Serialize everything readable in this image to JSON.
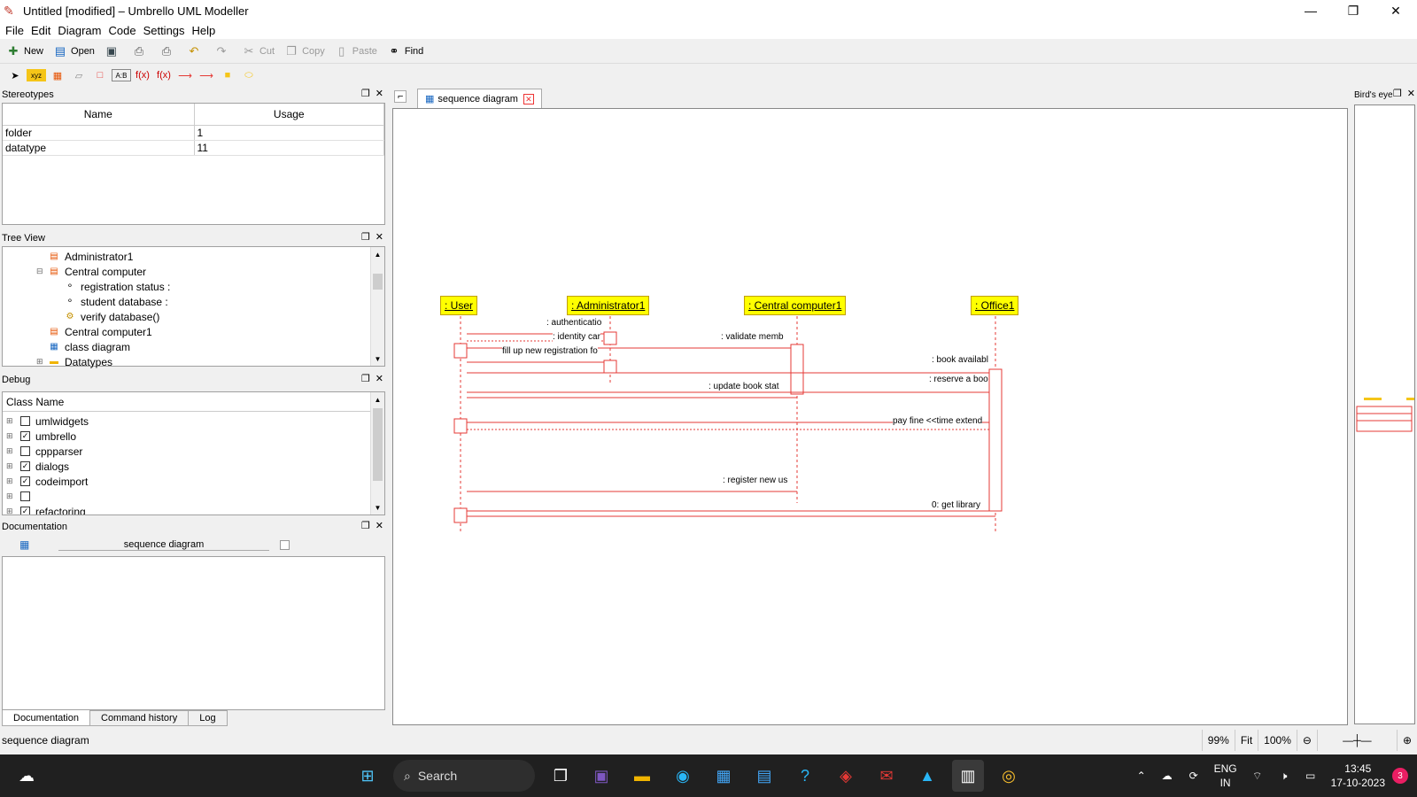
{
  "window": {
    "title": "Untitled [modified] – Umbrello UML Modeller",
    "minimize": "—",
    "maximize": "❐",
    "close": "✕"
  },
  "menu": [
    "File",
    "Edit",
    "Diagram",
    "Code",
    "Settings",
    "Help"
  ],
  "toolbar": {
    "new": "New",
    "open": "Open",
    "cut": "Cut",
    "copy": "Copy",
    "paste": "Paste",
    "find": "Find"
  },
  "stereotypes": {
    "title": "Stereotypes",
    "columns": [
      "Name",
      "Usage"
    ],
    "rows": [
      {
        "name": "folder",
        "usage": "1"
      },
      {
        "name": "datatype",
        "usage": "11"
      }
    ]
  },
  "tree_view": {
    "title": "Tree View",
    "items": [
      {
        "label": "Administrator1",
        "icon": "class-icon"
      },
      {
        "label": "Central computer",
        "icon": "class-icon"
      },
      {
        "label": "registration status :",
        "icon": "attribute-icon"
      },
      {
        "label": "student database :",
        "icon": "attribute-icon"
      },
      {
        "label": "verify database()",
        "icon": "operation-icon"
      },
      {
        "label": "Central computer1",
        "icon": "object-icon"
      },
      {
        "label": "class diagram",
        "icon": "diagram-icon"
      },
      {
        "label": "Datatypes",
        "icon": "folder-icon"
      }
    ]
  },
  "debug": {
    "title": "Debug",
    "column": "Class Name",
    "rows": [
      {
        "label": "umlwidgets",
        "checked": false
      },
      {
        "label": "umbrello",
        "checked": true
      },
      {
        "label": "cppparser",
        "checked": false
      },
      {
        "label": "dialogs",
        "checked": true
      },
      {
        "label": "codeimport",
        "checked": true
      },
      {
        "label": "",
        "checked": false
      },
      {
        "label": "refactoring",
        "checked": true
      }
    ]
  },
  "documentation": {
    "title": "Documentation",
    "field": "sequence diagram"
  },
  "bottom_tabs": [
    "Documentation",
    "Command history",
    "Log"
  ],
  "diagram_tab": {
    "label": "sequence diagram"
  },
  "birds_eye": {
    "title": "Bird's eye"
  },
  "lifelines": [
    ": User",
    ": Administrator1",
    ": Central computer1",
    ": Office1"
  ],
  "messages": [
    ": authenticatio",
    ": identity car",
    ": validate memb",
    "fill up new registration fo",
    ": book availabl",
    ": reserve a boo",
    ": update book stat",
    "pay fine <<time extend",
    ": register new us",
    "0: get library"
  ],
  "status": {
    "text": "sequence diagram",
    "zoom": "99%",
    "fit": "Fit",
    "hundred": "100%"
  },
  "taskbar": {
    "search": "Search",
    "lang1": "ENG",
    "lang2": "IN",
    "time": "13:45",
    "date": "17-10-2023",
    "badge": "3"
  },
  "colors": {
    "lifeline_fill": "#ffff00",
    "message": "#e53935"
  }
}
